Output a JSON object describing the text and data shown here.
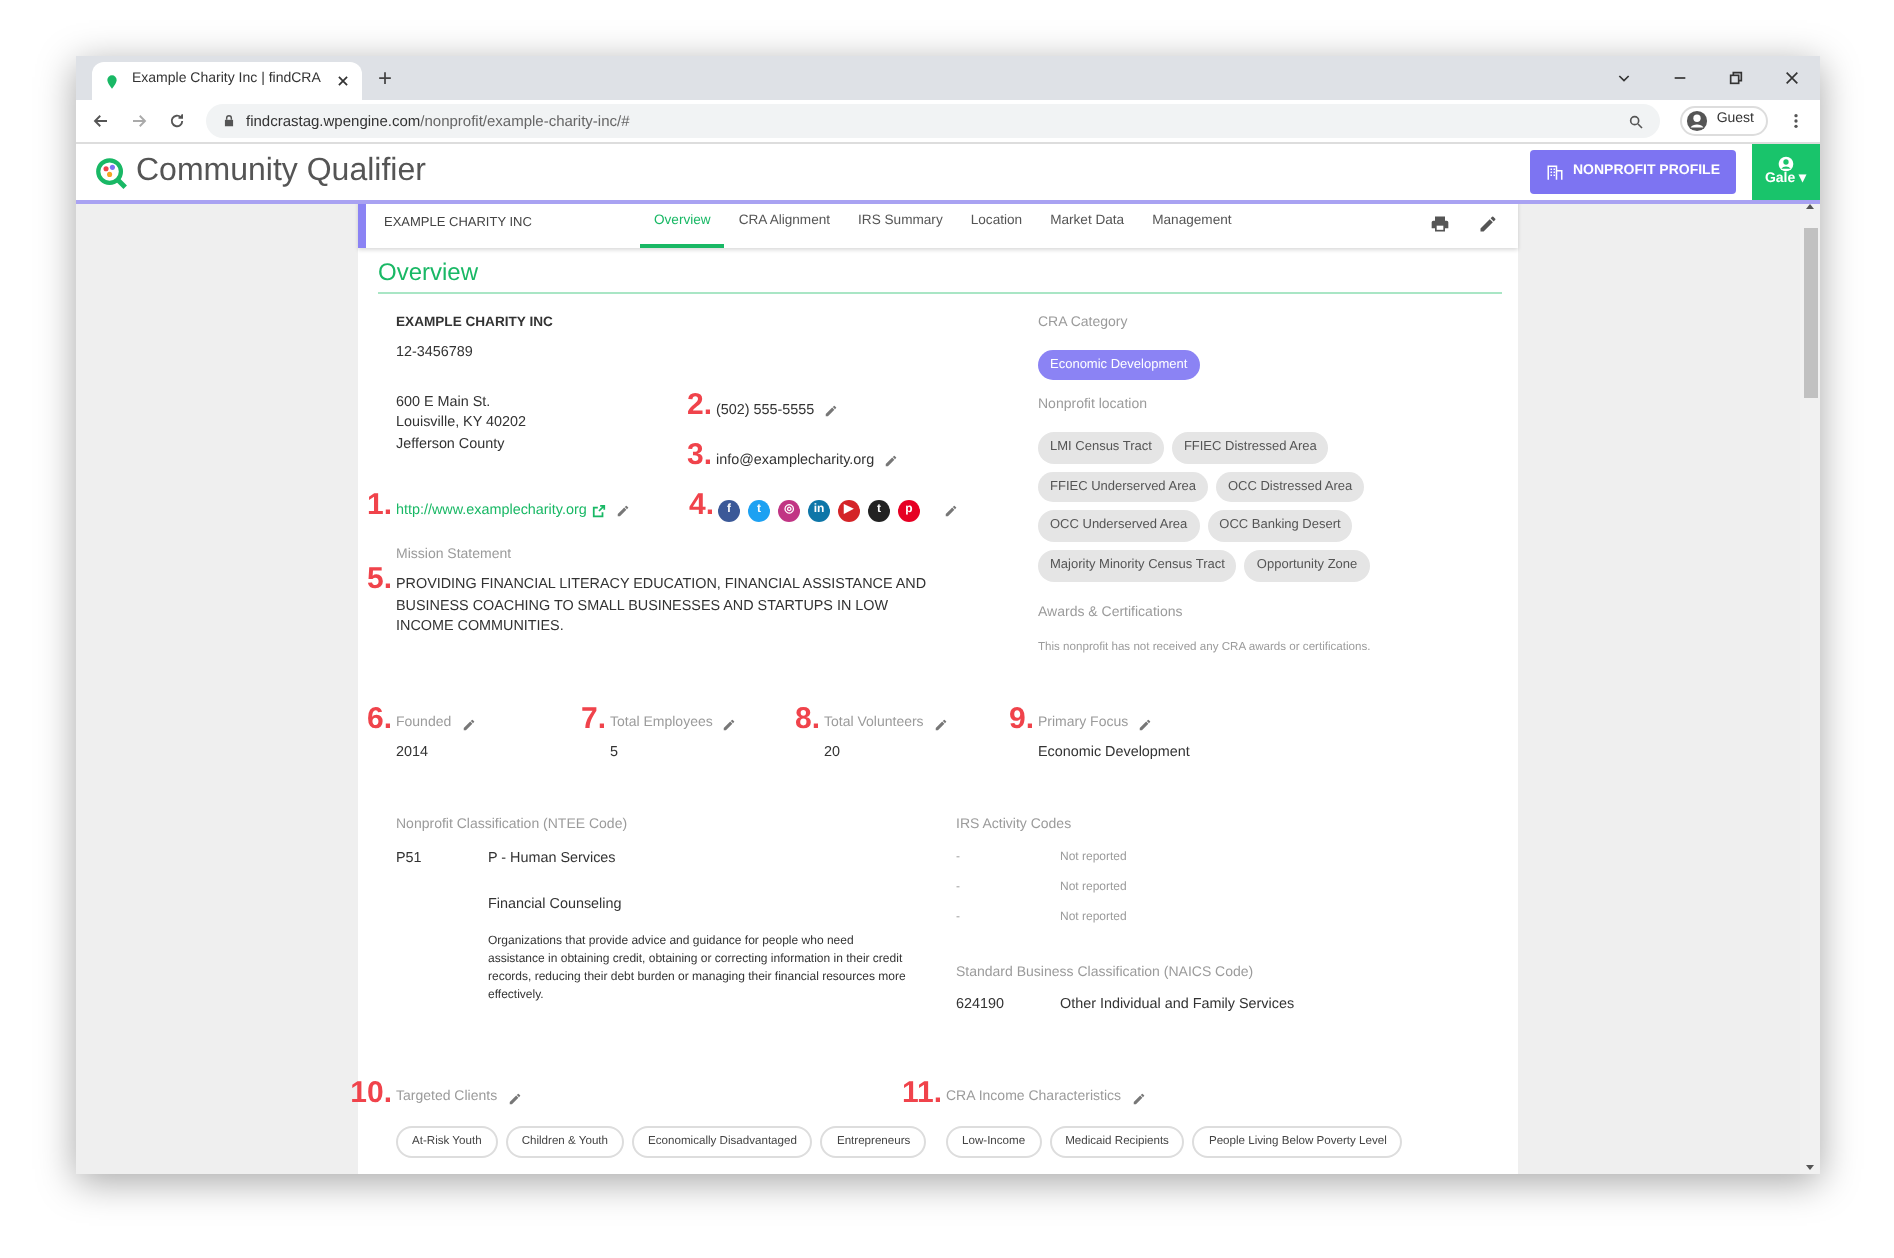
{
  "browser": {
    "tab_title": "Example Charity Inc | findCRA",
    "new_tab": "+",
    "url_host": "findcrastag.wpengine.com",
    "url_path": "/nonprofit/example-charity-inc/#",
    "profile": "Guest"
  },
  "header": {
    "app_name": "Community Qualifier",
    "profile_button": "NONPROFIT PROFILE",
    "user": "Gale",
    "user_caret": "▾"
  },
  "nav": {
    "org_name": "EXAMPLE CHARITY INC",
    "tabs": [
      {
        "label": "Overview",
        "selected": true
      },
      {
        "label": "CRA Alignment",
        "selected": false
      },
      {
        "label": "IRS Summary",
        "selected": false
      },
      {
        "label": "Location",
        "selected": false
      },
      {
        "label": "Market Data",
        "selected": false
      },
      {
        "label": "Management",
        "selected": false
      }
    ]
  },
  "section_title": "Overview",
  "org": {
    "name": "EXAMPLE CHARITY INC",
    "ein": "12-3456789",
    "address_lines": [
      "600 E Main St.",
      "Louisville, KY 40202",
      "Jefferson County"
    ],
    "phone": {
      "marker": "2.",
      "text": "(502) 555-5555"
    },
    "email": {
      "marker": "3.",
      "text": "info@examplecharity.org"
    },
    "website": {
      "marker": "1.",
      "text": "http://www.examplecharity.org"
    },
    "socials": {
      "marker": "4.",
      "items": [
        {
          "glyph": "f",
          "color": "#3b5998"
        },
        {
          "glyph": "t",
          "color": "#1da1f2"
        },
        {
          "glyph": "◎",
          "color": "#c13584"
        },
        {
          "glyph": "in",
          "color": "#0e76a8"
        },
        {
          "glyph": "▶",
          "color": "#d42428"
        },
        {
          "glyph": "t",
          "color": "#222222"
        },
        {
          "glyph": "p",
          "color": "#e60023"
        }
      ]
    }
  },
  "mission": {
    "marker": "5.",
    "label": "Mission Statement",
    "text": "PROVIDING FINANCIAL LITERACY EDUCATION, FINANCIAL ASSISTANCE AND BUSINESS COACHING TO SMALL BUSINESSES AND STARTUPS IN LOW INCOME COMMUNITIES."
  },
  "cra_category": {
    "label": "CRA Category",
    "tags": [
      "Economic Development"
    ]
  },
  "nonprofit_location": {
    "label": "Nonprofit location",
    "tags": [
      "LMI Census Tract",
      "FFIEC Distressed Area",
      "FFIEC Underserved Area",
      "OCC Distressed Area",
      "OCC Underserved Area",
      "OCC Banking Desert",
      "Majority Minority Census Tract",
      "Opportunity Zone"
    ]
  },
  "awards": {
    "label": "Awards & Certifications",
    "text": "This nonprofit has not received any CRA awards or certifications."
  },
  "stats": [
    {
      "marker": "6.",
      "label": "Founded",
      "value": "2014"
    },
    {
      "marker": "7.",
      "label": "Total Employees",
      "value": "5"
    },
    {
      "marker": "8.",
      "label": "Total Volunteers",
      "value": "20"
    },
    {
      "marker": "9.",
      "label": "Primary Focus",
      "value": "Economic Development"
    }
  ],
  "ntee": {
    "label": "Nonprofit Classification (NTEE Code)",
    "code": "P51",
    "category": "P - Human Services",
    "subcategory": "Financial Counseling",
    "description": "Organizations that provide advice and guidance for people who need assistance in obtaining credit, obtaining or correcting information in their credit records, reducing their debt burden or managing their financial resources more effectively."
  },
  "irs_activity": {
    "label": "IRS Activity Codes",
    "rows": [
      {
        "code": "-",
        "value": "Not reported"
      },
      {
        "code": "-",
        "value": "Not reported"
      },
      {
        "code": "-",
        "value": "Not reported"
      }
    ]
  },
  "naics": {
    "label": "Standard Business Classification (NAICS Code)",
    "code": "624190",
    "text": "Other Individual and Family Services"
  },
  "targeted_clients": {
    "marker": "10.",
    "label": "Targeted Clients",
    "tags": [
      "At-Risk Youth",
      "Children & Youth",
      "Economically Disadvantaged",
      "Entrepreneurs"
    ]
  },
  "income_characteristics": {
    "marker": "11.",
    "label": "CRA Income Characteristics",
    "tags": [
      "Low-Income",
      "Medicaid Recipients",
      "People Living Below Poverty Level"
    ]
  }
}
